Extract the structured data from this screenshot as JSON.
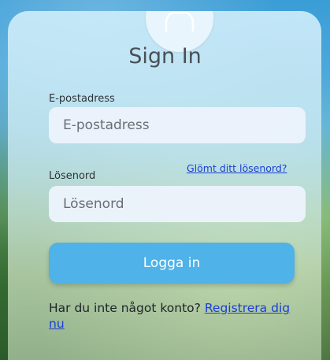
{
  "form": {
    "title": "Sign In",
    "email_label": "E-postadress",
    "email_placeholder": "E-postadress",
    "password_label": "Lösenord",
    "password_placeholder": "Lösenord",
    "forgot_password_link": "Glömt ditt lösenord?",
    "login_button": "Logga in",
    "register_prompt": "Har du inte något konto?",
    "register_link": "Registrera dig nu"
  },
  "colors": {
    "button": "#4fb2e8",
    "link": "#1a3fd6",
    "title": "#4a4f55"
  },
  "icons": {
    "avatar": "user-icon"
  }
}
